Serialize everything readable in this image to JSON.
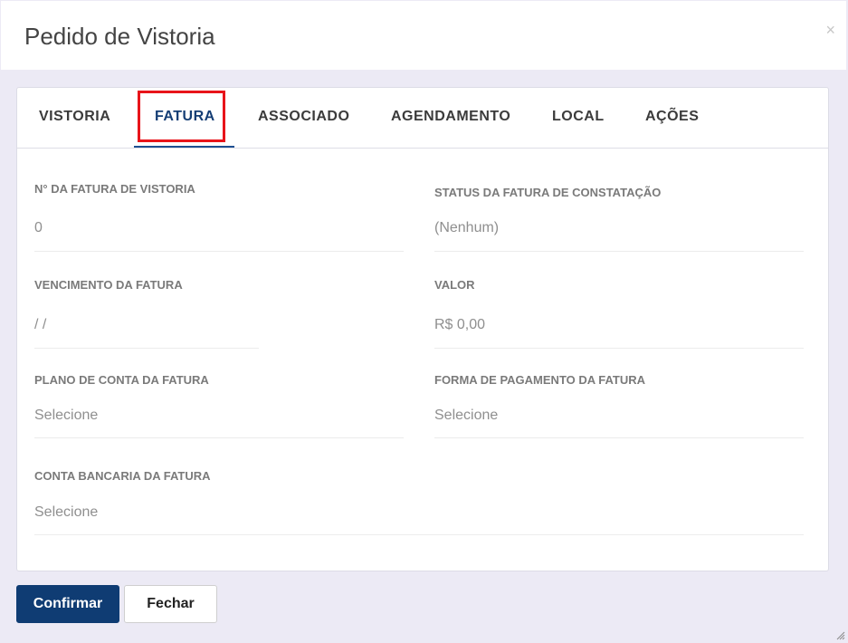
{
  "dialog": {
    "title": "Pedido de Vistoria",
    "close_symbol": "×"
  },
  "tabs": [
    {
      "label": "VISTORIA",
      "active": false
    },
    {
      "label": "FATURA",
      "active": true
    },
    {
      "label": "ASSOCIADO",
      "active": false
    },
    {
      "label": "AGENDAMENTO",
      "active": false
    },
    {
      "label": "LOCAL",
      "active": false
    },
    {
      "label": "AÇÕES",
      "active": false
    }
  ],
  "fields": {
    "invoice_number": {
      "label": "N° DA FATURA DE VISTORIA",
      "value": "0"
    },
    "invoice_status": {
      "label": "STATUS DA FATURA DE CONSTATAÇÃO",
      "value": "(Nenhum)"
    },
    "due_date": {
      "label": "VENCIMENTO DA FATURA",
      "value": "/ /"
    },
    "amount": {
      "label": "VALOR",
      "value": "R$ 0,00"
    },
    "account_plan": {
      "label": "PLANO DE CONTA DA FATURA",
      "value": "Selecione"
    },
    "payment_method": {
      "label": "FORMA DE PAGAMENTO DA FATURA",
      "value": "Selecione"
    },
    "bank_account": {
      "label": "CONTA BANCARIA DA FATURA",
      "value": "Selecione"
    }
  },
  "buttons": {
    "confirm": "Confirmar",
    "close": "Fechar"
  },
  "colors": {
    "accent": "#0f3c73",
    "highlight": "#e8141a",
    "background": "#eceaf5"
  }
}
